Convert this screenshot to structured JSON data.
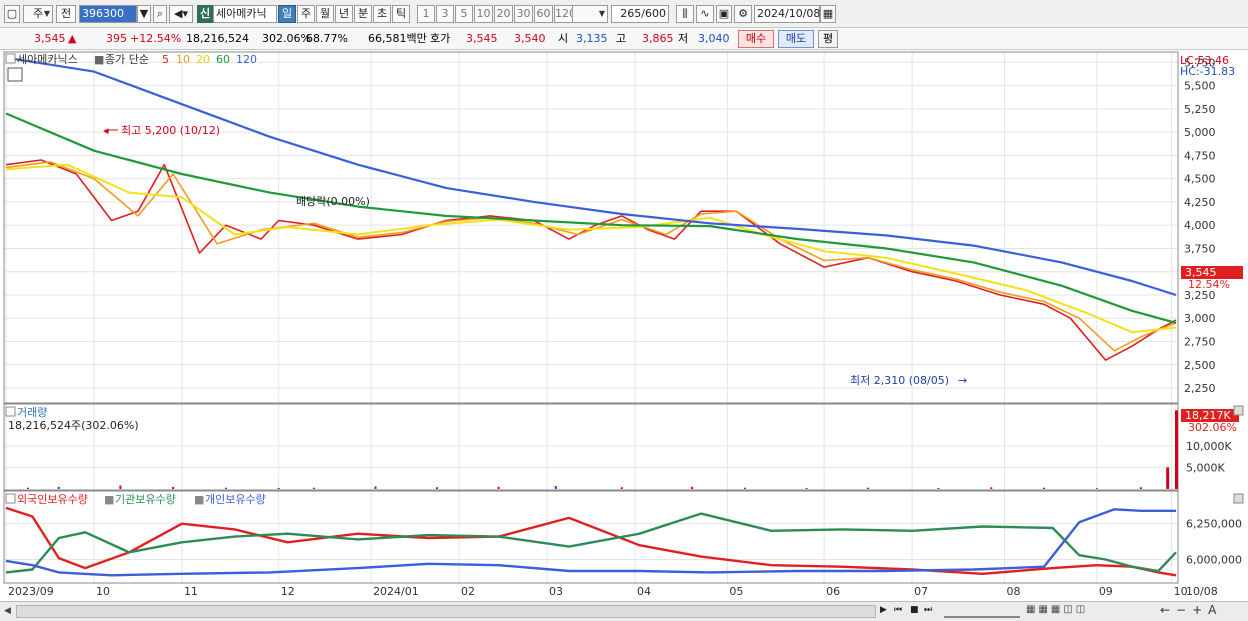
{
  "toolbar": {
    "period_unit": "주",
    "prev_label": "전",
    "stock_code": "396300",
    "market_badge": "신",
    "stock_name": "세아메카닉",
    "timeframes": [
      "일",
      "주",
      "월",
      "년",
      "분",
      "초",
      "틱"
    ],
    "active_timeframe": "일",
    "intervals": [
      "1",
      "3",
      "5",
      "10",
      "20",
      "30",
      "60",
      "120"
    ],
    "count_display": "265",
    "count_total": "/600",
    "date": "2024/10/08"
  },
  "quote": {
    "price": "3,545",
    "change": "395",
    "change_pct": "+12.54%",
    "volume": "18,216,524",
    "volume_ratio": "302.06%",
    "turnover_ratio": "68.77%",
    "amount": "66,581백만",
    "bid_label": "호가",
    "ask_price": "3,545",
    "bid_price": "3,540",
    "open_label": "시",
    "open": "3,135",
    "high_label": "고",
    "high": "3,865",
    "low_label": "저",
    "low": "3,040",
    "buy_label": "매수",
    "sell_label": "매도",
    "flat_label": "평"
  },
  "price_panel": {
    "name": "세아메카닉스",
    "ma_label": "종가 단순",
    "ma_periods": [
      "5",
      "10",
      "20",
      "60",
      "120"
    ],
    "lc": "LC:53.46",
    "hc": "HC:-31.83",
    "high_note": "최고 5,200 (10/12)",
    "low_note": "최저 2,310 (08/05)",
    "dividend_note": "배당락(0.00%)",
    "current_price_tag": "3,545",
    "current_pct_tag": "12.54%"
  },
  "volume_panel": {
    "title": "거래량",
    "value_text": "18,216,524주(302.06%)",
    "tag_value": "18,217K",
    "tag_pct": "302.06%",
    "axis_labels": [
      "10,000K",
      "5,000K"
    ]
  },
  "holding_panel": {
    "labels": [
      "외국인보유수량",
      "기관보유수량",
      "개인보유수량"
    ],
    "axis_labels": [
      "6,250,000",
      "6,000,000"
    ]
  },
  "colors": {
    "up": "#d0021b",
    "down": "#1f4fbf",
    "ma5": "#e02020",
    "ma10": "#f39a1e",
    "ma20": "#f2e21a",
    "ma60": "#1e9a3a",
    "ma120": "#3a5fd8",
    "foreign": "#e02020",
    "institution": "#2e8b57",
    "retail": "#3a5fd8"
  },
  "chart_data": {
    "type": "line",
    "x_labels": [
      "2023/09",
      "10",
      "11",
      "12",
      "2024/01",
      "02",
      "03",
      "04",
      "05",
      "06",
      "07",
      "08",
      "09",
      "10",
      "10/08"
    ],
    "price_axis_labels": [
      "5,750",
      "5,500",
      "5,250",
      "5,000",
      "4,750",
      "4,500",
      "4,250",
      "4,000",
      "3,750",
      "3,500",
      "3,250",
      "3,000",
      "2,750",
      "2,500",
      "2,250"
    ],
    "price_ylim": [
      2100,
      5850
    ],
    "series": [
      {
        "name": "5",
        "x": [
          0,
          8,
          16,
          24,
          30,
          36,
          44,
          50,
          58,
          62,
          70,
          80,
          90,
          100,
          110,
          120,
          128,
          134,
          140,
          146,
          152,
          158,
          166,
          176,
          186,
          196,
          206,
          216,
          226,
          236,
          242,
          250,
          256,
          262,
          266
        ],
        "y": [
          4650,
          4700,
          4550,
          4050,
          4150,
          4650,
          3700,
          4000,
          3850,
          4050,
          4000,
          3850,
          3900,
          4050,
          4100,
          4050,
          3850,
          4000,
          4100,
          3950,
          3850,
          4150,
          4150,
          3800,
          3550,
          3650,
          3500,
          3400,
          3250,
          3150,
          3000,
          2550,
          2700,
          2880,
          2980
        ]
      },
      {
        "name": "10",
        "x": [
          0,
          10,
          20,
          30,
          38,
          48,
          58,
          70,
          80,
          90,
          100,
          110,
          120,
          130,
          140,
          150,
          158,
          166,
          176,
          186,
          196,
          206,
          216,
          226,
          236,
          244,
          252,
          258,
          266
        ],
        "y": [
          4620,
          4680,
          4500,
          4100,
          4550,
          3800,
          3950,
          4020,
          3870,
          3920,
          4040,
          4080,
          4020,
          3900,
          4060,
          3900,
          4120,
          4150,
          3850,
          3620,
          3650,
          3520,
          3420,
          3280,
          3180,
          3000,
          2650,
          2800,
          2950
        ]
      },
      {
        "name": "20",
        "x": [
          0,
          14,
          28,
          40,
          52,
          64,
          80,
          96,
          112,
          128,
          144,
          160,
          172,
          186,
          200,
          216,
          232,
          246,
          256,
          266
        ],
        "y": [
          4600,
          4650,
          4350,
          4300,
          3900,
          3980,
          3900,
          4000,
          4060,
          3950,
          3980,
          4080,
          3900,
          3720,
          3650,
          3480,
          3300,
          3050,
          2850,
          2900
        ]
      },
      {
        "name": "60",
        "x": [
          0,
          20,
          40,
          60,
          80,
          100,
          120,
          140,
          160,
          180,
          200,
          220,
          240,
          256,
          266
        ],
        "y": [
          5200,
          4800,
          4550,
          4350,
          4200,
          4100,
          4050,
          4000,
          3990,
          3850,
          3750,
          3600,
          3350,
          3080,
          2950
        ]
      },
      {
        "name": "120",
        "x": [
          0,
          20,
          40,
          60,
          80,
          100,
          120,
          140,
          160,
          180,
          200,
          220,
          240,
          256,
          266
        ],
        "y": [
          5800,
          5650,
          5300,
          4950,
          4650,
          4400,
          4250,
          4120,
          4020,
          3960,
          3890,
          3780,
          3600,
          3400,
          3250
        ]
      }
    ],
    "volume_axis_labels": [
      "10,000K",
      "5,000K"
    ],
    "volume_ylim": [
      0,
      19000
    ],
    "volume": {
      "x": [
        5,
        12,
        26,
        38,
        50,
        62,
        70,
        84,
        98,
        112,
        125,
        140,
        156,
        168,
        182,
        196,
        212,
        224,
        236,
        248,
        258,
        264,
        266
      ],
      "values": [
        300,
        500,
        800,
        450,
        300,
        250,
        300,
        600,
        400,
        500,
        700,
        400,
        500,
        300,
        250,
        300,
        250,
        400,
        300,
        200,
        400,
        5000,
        18217
      ]
    },
    "holding_axis_labels": [
      "6,250,000",
      "6,000,000"
    ],
    "holding_ylim": [
      5850000,
      6450000
    ],
    "holdings": [
      {
        "name": "외국인보유수량",
        "x": [
          0,
          6,
          12,
          18,
          28,
          40,
          52,
          64,
          80,
          96,
          112,
          128,
          144,
          158,
          174,
          190,
          206,
          222,
          238,
          248,
          256,
          262,
          266
        ],
        "y": [
          6360000,
          6300000,
          6010000,
          5940000,
          6050000,
          6250000,
          6210000,
          6120000,
          6180000,
          6150000,
          6160000,
          6290000,
          6100000,
          6020000,
          5960000,
          5950000,
          5930000,
          5900000,
          5940000,
          5960000,
          5950000,
          5910000,
          5890000
        ]
      },
      {
        "name": "기관보유수량",
        "x": [
          0,
          6,
          12,
          18,
          28,
          40,
          52,
          64,
          80,
          96,
          112,
          128,
          144,
          158,
          174,
          190,
          206,
          222,
          238,
          244,
          250,
          256,
          262,
          266
        ],
        "y": [
          5910000,
          5930000,
          6150000,
          6190000,
          6050000,
          6120000,
          6160000,
          6180000,
          6140000,
          6170000,
          6160000,
          6090000,
          6180000,
          6320000,
          6200000,
          6210000,
          6200000,
          6230000,
          6220000,
          6030000,
          6000000,
          5950000,
          5920000,
          6050000
        ]
      },
      {
        "name": "개인보유수량",
        "x": [
          0,
          6,
          12,
          24,
          40,
          60,
          80,
          96,
          112,
          128,
          144,
          160,
          180,
          200,
          220,
          236,
          244,
          252,
          258,
          266
        ],
        "y": [
          5990000,
          5960000,
          5910000,
          5890000,
          5900000,
          5910000,
          5940000,
          5970000,
          5960000,
          5920000,
          5920000,
          5910000,
          5920000,
          5920000,
          5930000,
          5950000,
          6260000,
          6350000,
          6340000,
          6340000
        ]
      }
    ]
  }
}
